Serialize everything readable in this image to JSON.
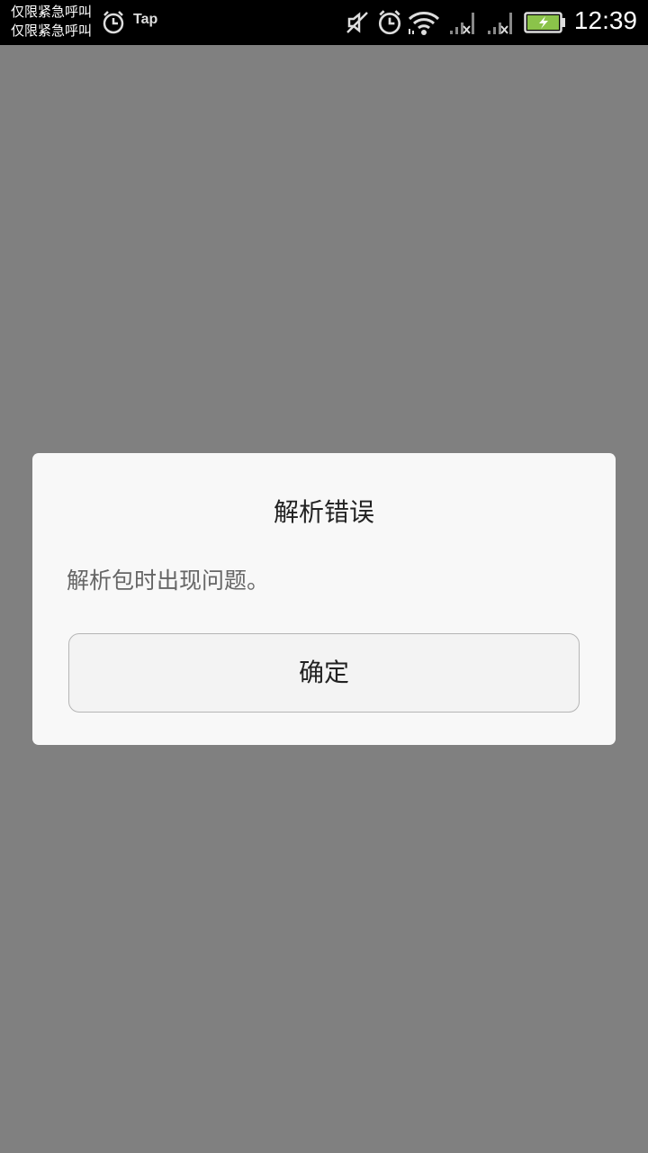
{
  "status_bar": {
    "carrier_line_1": "仅限紧急呼叫",
    "carrier_line_2": "仅限紧急呼叫",
    "app_notification": "Tap",
    "time": "12:39",
    "icons": [
      "alarm-icon",
      "tap-notification-icon",
      "vibrate-off-icon",
      "alarm-icon",
      "wifi-icon",
      "signal-no-service-icon",
      "signal-no-service-icon",
      "battery-charging-icon"
    ],
    "battery_color": "#8bc34a"
  },
  "dialog": {
    "title": "解析错误",
    "message": "解析包时出现问题。",
    "ok_label": "确定"
  },
  "colors": {
    "backdrop": "#808080",
    "dialog_bg": "#f8f8f8"
  }
}
